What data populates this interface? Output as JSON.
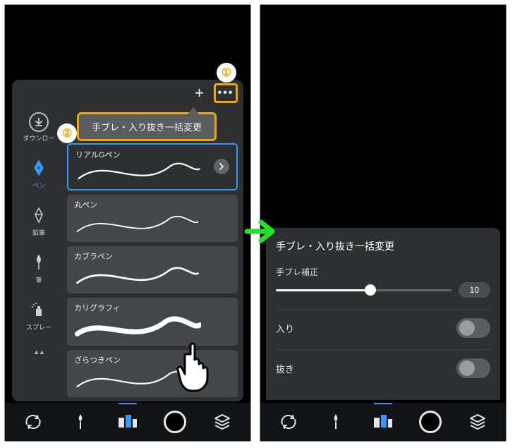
{
  "callouts": {
    "n1": "①",
    "n2": "②"
  },
  "leftScreen": {
    "plusLabel": "+",
    "moreLabel": "•••",
    "downloadLabel": "ダウンロー",
    "menuPopup": "手ブレ・入り抜き一括変更",
    "sideCategories": [
      {
        "id": "pen",
        "label": "ペン",
        "active": true
      },
      {
        "id": "pencil",
        "label": "鉛筆",
        "active": false
      },
      {
        "id": "brush",
        "label": "筆",
        "active": false
      },
      {
        "id": "spray",
        "label": "スプレー",
        "active": false
      }
    ],
    "brushes": [
      {
        "name": "リアルGペン",
        "selected": true
      },
      {
        "name": "丸ペン",
        "selected": false
      },
      {
        "name": "カブラペン",
        "selected": false
      },
      {
        "name": "カリグラフィ",
        "selected": false
      },
      {
        "name": "ざらつきペン",
        "selected": false
      }
    ]
  },
  "rightScreen": {
    "title": "手ブレ・入り抜き一括変更",
    "stabilizeLabel": "手ブレ補正",
    "stabilizeValue": "10",
    "toggles": [
      {
        "label": "入り",
        "on": false
      },
      {
        "label": "抜き",
        "on": false
      }
    ]
  },
  "bottomBar": {
    "items": [
      "transform",
      "brush",
      "color-palette",
      "current-color",
      "layers"
    ]
  }
}
